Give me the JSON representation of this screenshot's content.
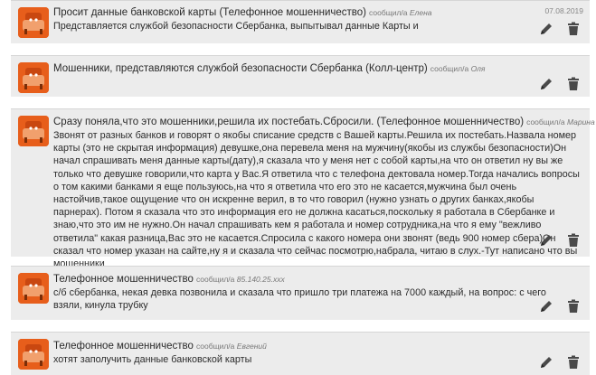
{
  "posts": [
    {
      "title": "Просит данные банковской карты (Телефонное мошенничество)",
      "author_prefix": "сообщил/а",
      "author": "Елена",
      "date": "07.08.2019",
      "body": "Представляется службой безопасности Сбербанка, выпытывал данные Карты и"
    },
    {
      "title": "Мошенники, представляются службой безопасности Сбербанка (Колл-центр)",
      "author_prefix": "сообщил/а",
      "author": "Оля",
      "body": ""
    },
    {
      "title": "Сразу поняла,что это мошенники,решила их постебать.Сбросили. (Телефонное мошенничество)",
      "author_prefix": "сообщил/а",
      "author": "Марина",
      "body": "Звонят от разных банков и говорят о якобы списание средств с Вашей карты.Решила их постебать.Назвала номер карты (это не скрытая информация) девушке,она перевела меня на мужчину(якобы из службы безопасности)Он начал спрашивать меня данные карты(дату),я сказала что у меня нет с собой карты,на что он ответил ну вы же только что девушке говорили,что карта у Вас.Я ответила что с телефона дектовала номер.Тогда начались вопросы о том какими банками я еще пользуюсь,на что я ответила что его это не касается,мужчина был очень настойчив,такое ощущение что он искренне верил, в то что говорил (нужно узнать о других банках,якобы парнерах). Потом я сказала что это информация его не должна касаться,поскольку я работала в Сбербанке и знаю,что это им не нужно.Он начал спрашивать кем я работала и номер сотрудника,на что я ему \"вежливо ответила\" какая разница,Вас это не касается.Спросила с какого номера они звонят (ведь 900 номер сбера)Он сказал что номер указан на сайте,ну я и сказала что сейчас посмотрю,набрала, читаю в слух.-Тут написано что вы мошенники"
    },
    {
      "title": "Телефонное мошенничество",
      "author_prefix": "сообщил/а",
      "author": "85.140.25.xxx",
      "body": "с/б сбербанка, некая девка позвонила и сказала что пришло три платежа на 7000 каждый, на вопрос: с чего взяли, кинула трубку"
    },
    {
      "title": "Телефонное мошенничество",
      "author_prefix": "сообщил/а",
      "author": "Евгений",
      "body": "хотят заполучить данные банковской карты"
    }
  ],
  "icons": {
    "edit": "pencil-icon",
    "delete": "trash-icon",
    "avatar": "orange-chair-avatar"
  },
  "colors": {
    "card_bg": "#ececec",
    "avatar_bg": "#e75e1b",
    "icon_color": "#4a4a4a"
  }
}
